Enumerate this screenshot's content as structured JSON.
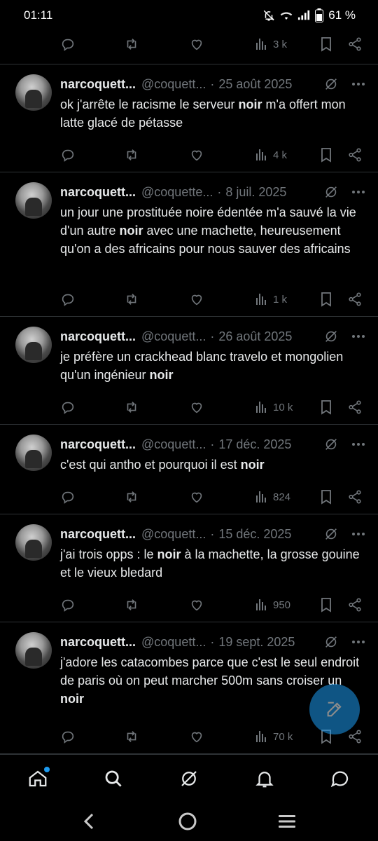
{
  "status_bar": {
    "time": "01:11",
    "battery": "61 %"
  },
  "top_partial": {
    "views": "3 k"
  },
  "tweets": [
    {
      "name": "narcoquett...",
      "handle": "@coquett...",
      "date": "25 août 2025",
      "text_parts": [
        "ok j'arrête le racisme le serveur ",
        "noir",
        " m'a offert mon latte glacé de pétasse"
      ],
      "views": "4 k"
    },
    {
      "name": "narcoquett...",
      "handle": "@coquette...",
      "date": "8 juil. 2025",
      "text_parts": [
        "un jour une prostituée noire édentée m'a sauvé la vie d'un autre ",
        "noir",
        " avec une machette, heureusement qu'on a des africains pour nous sauver des africains"
      ],
      "views": "1 k"
    },
    {
      "name": "narcoquett...",
      "handle": "@coquett...",
      "date": "26 août 2025",
      "text_parts": [
        "je préfère un crackhead blanc travelo et mongolien qu'un ingénieur ",
        "noir",
        ""
      ],
      "views": "10 k"
    },
    {
      "name": "narcoquett...",
      "handle": "@coquett...",
      "date": "17 déc. 2025",
      "text_parts": [
        "c'est qui antho et pourquoi il est ",
        "noir",
        ""
      ],
      "views": "824"
    },
    {
      "name": "narcoquett...",
      "handle": "@coquett...",
      "date": "15 déc. 2025",
      "text_parts": [
        "j'ai trois opps : le ",
        "noir",
        " à la machette, la grosse gouine et le vieux bledard"
      ],
      "views": "950"
    },
    {
      "name": "narcoquett...",
      "handle": "@coquett...",
      "date": "19 sept. 2025",
      "text_parts": [
        "j'adore les catacombes parce que c'est le seul endroit de paris où on peut marcher 500m sans croiser un ",
        "noir",
        ""
      ],
      "views": "70 k"
    }
  ],
  "colors": {
    "accent": "#1d9bf0",
    "muted": "#71767b",
    "text": "#e7e9ea",
    "divider": "#2f3336"
  },
  "icons": {
    "actions": [
      "reply-icon",
      "retweet-icon",
      "like-icon",
      "views-icon",
      "bookmark-icon",
      "share-icon"
    ],
    "nav": [
      "home-icon",
      "search-icon",
      "grok-icon",
      "notifications-icon",
      "messages-icon"
    ],
    "system": [
      "back-icon",
      "home-circle-icon",
      "recents-icon"
    ]
  }
}
